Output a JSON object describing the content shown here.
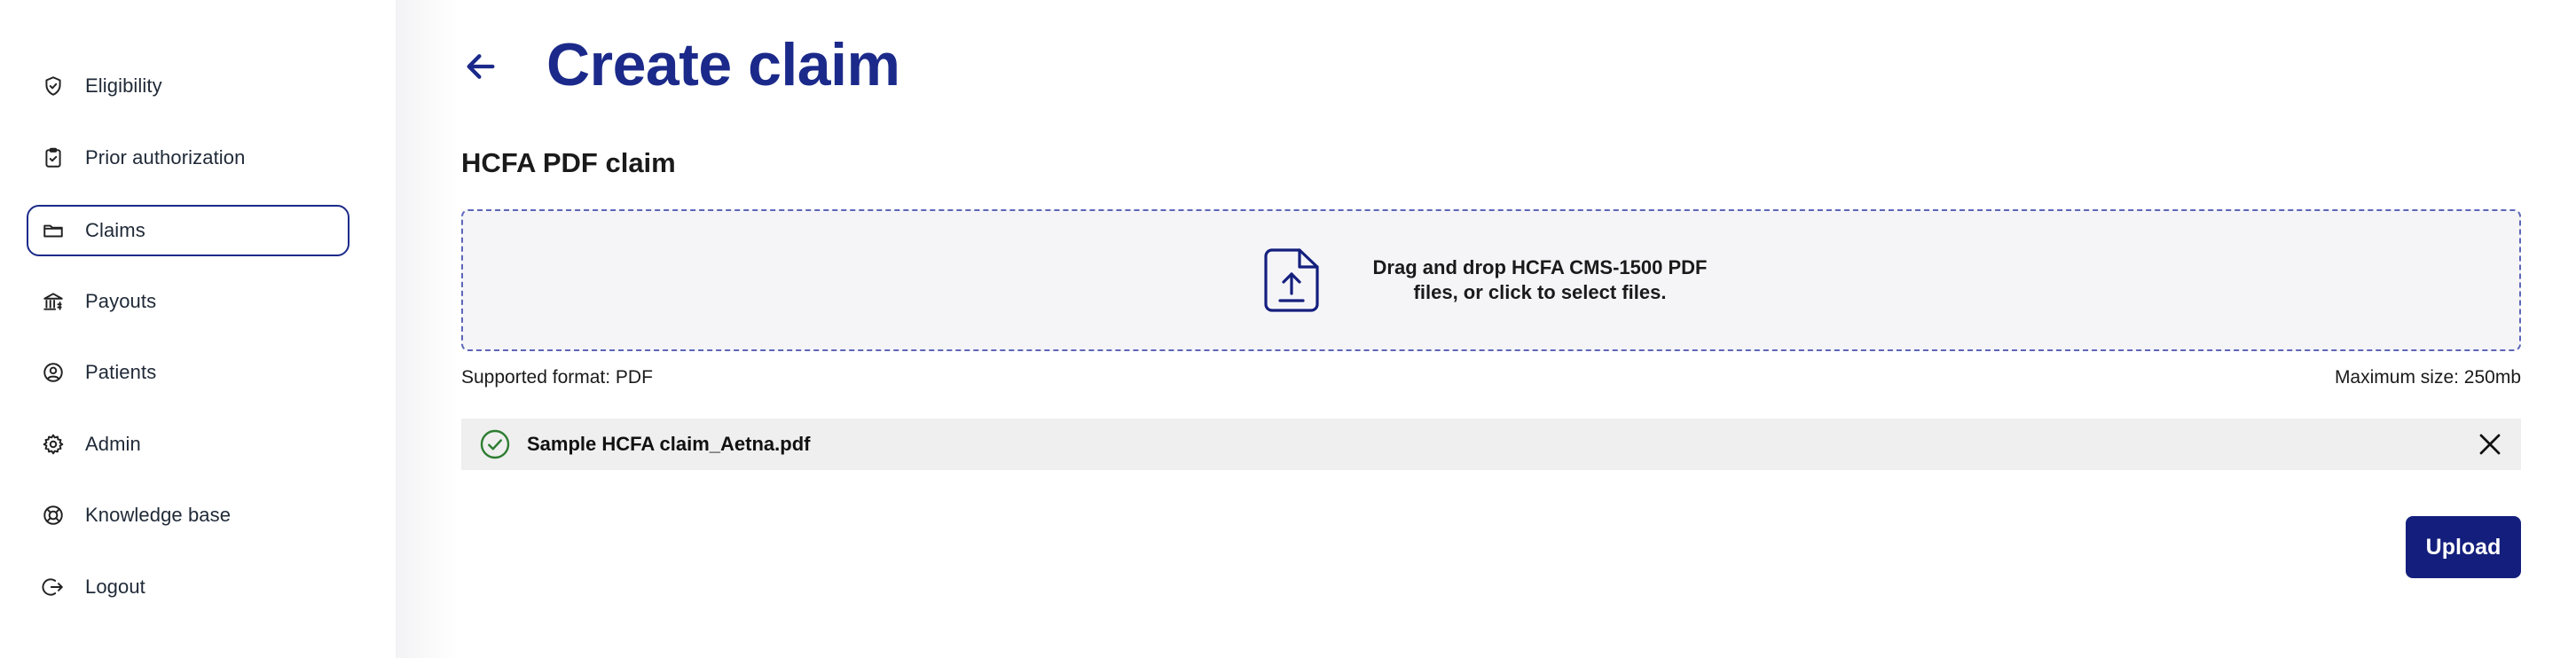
{
  "sidebar": {
    "items": [
      {
        "label": "Eligibility",
        "icon": "shield-check-icon",
        "active": false
      },
      {
        "label": "Prior authorization",
        "icon": "clipboard-check-icon",
        "active": false
      },
      {
        "label": "Claims",
        "icon": "folder-icon",
        "active": true
      },
      {
        "label": "Payouts",
        "icon": "bank-icon",
        "active": false
      },
      {
        "label": "Patients",
        "icon": "user-circle-icon",
        "active": false
      },
      {
        "label": "Admin",
        "icon": "gear-icon",
        "active": false
      },
      {
        "label": "Knowledge base",
        "icon": "lifebuoy-icon",
        "active": false
      },
      {
        "label": "Logout",
        "icon": "logout-icon",
        "active": false
      }
    ]
  },
  "header": {
    "title": "Create claim",
    "back_icon": "arrow-left-icon"
  },
  "section": {
    "title": "HCFA PDF claim"
  },
  "dropzone": {
    "icon": "file-upload-icon",
    "text": "Drag and drop HCFA CMS-1500 PDF files, or click to select files."
  },
  "meta": {
    "supported_format": "Supported format: PDF",
    "max_size": "Maximum size: 250mb"
  },
  "file": {
    "name": "Sample HCFA claim_Aetna.pdf",
    "status_icon": "check-circle-icon",
    "remove_icon": "close-icon"
  },
  "actions": {
    "upload_label": "Upload"
  },
  "colors": {
    "accent": "#1b2a8a",
    "button": "#141f7d",
    "success": "#2e7d32",
    "dropzone_bg": "#f5f5f8",
    "file_row_bg": "#efefef"
  }
}
